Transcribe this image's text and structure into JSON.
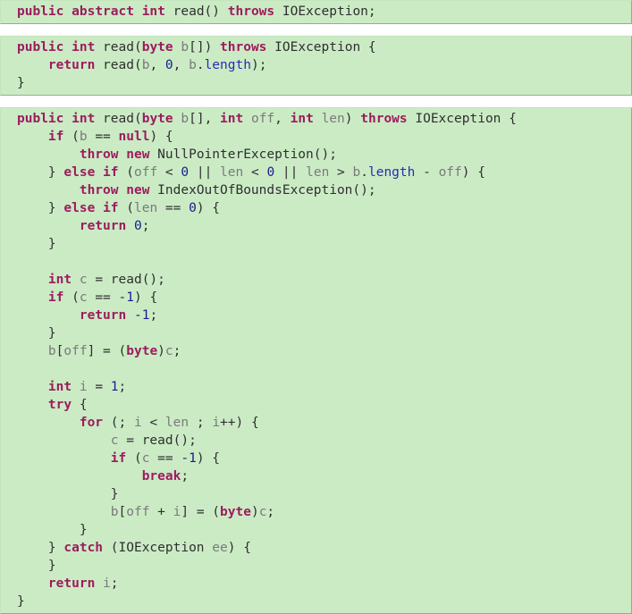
{
  "figure": {
    "name": "java-inputstream-read-methods-code-listing",
    "language": "Java",
    "colors": {
      "background": "#ffffff",
      "code_background": "#cbebc5",
      "keyword": "#9c1c5e",
      "identifier": "#2f2f2f",
      "variable": "#7a7a7a",
      "number": "#1b1b8c",
      "field": "#2a2ab0",
      "border": "#9aa89a"
    }
  },
  "blocks": [
    {
      "id": "block-1",
      "name": "abstract-read-declaration",
      "lines": [
        {
          "indent": 0,
          "tokens": [
            {
              "t": "public",
              "c": "kw"
            },
            {
              "t": " ",
              "c": "punc"
            },
            {
              "t": "abstract",
              "c": "kw"
            },
            {
              "t": " ",
              "c": "punc"
            },
            {
              "t": "int",
              "c": "kw"
            },
            {
              "t": " read() ",
              "c": "plain"
            },
            {
              "t": "throws",
              "c": "kw"
            },
            {
              "t": " IOException;",
              "c": "plain"
            }
          ]
        }
      ]
    },
    {
      "id": "block-2",
      "name": "read-byte-array-method",
      "lines": [
        {
          "indent": 0,
          "tokens": [
            {
              "t": "public",
              "c": "kw"
            },
            {
              "t": " ",
              "c": "punc"
            },
            {
              "t": "int",
              "c": "kw"
            },
            {
              "t": " read(",
              "c": "plain"
            },
            {
              "t": "byte",
              "c": "kw"
            },
            {
              "t": " ",
              "c": "punc"
            },
            {
              "t": "b",
              "c": "var"
            },
            {
              "t": "[]) ",
              "c": "plain"
            },
            {
              "t": "throws",
              "c": "kw"
            },
            {
              "t": " IOException {",
              "c": "plain"
            }
          ]
        },
        {
          "indent": 1,
          "tokens": [
            {
              "t": "return",
              "c": "kw"
            },
            {
              "t": " read(",
              "c": "plain"
            },
            {
              "t": "b",
              "c": "var"
            },
            {
              "t": ", ",
              "c": "plain"
            },
            {
              "t": "0",
              "c": "num"
            },
            {
              "t": ", ",
              "c": "plain"
            },
            {
              "t": "b",
              "c": "var"
            },
            {
              "t": ".",
              "c": "plain"
            },
            {
              "t": "length",
              "c": "fld"
            },
            {
              "t": ");",
              "c": "plain"
            }
          ]
        },
        {
          "indent": 0,
          "tokens": [
            {
              "t": "}",
              "c": "plain"
            }
          ]
        }
      ]
    },
    {
      "id": "block-3",
      "name": "read-byte-array-offset-length-method",
      "lines": [
        {
          "indent": 0,
          "tokens": [
            {
              "t": "public",
              "c": "kw"
            },
            {
              "t": " ",
              "c": "punc"
            },
            {
              "t": "int",
              "c": "kw"
            },
            {
              "t": " read(",
              "c": "plain"
            },
            {
              "t": "byte",
              "c": "kw"
            },
            {
              "t": " ",
              "c": "punc"
            },
            {
              "t": "b",
              "c": "var"
            },
            {
              "t": "[], ",
              "c": "plain"
            },
            {
              "t": "int",
              "c": "kw"
            },
            {
              "t": " ",
              "c": "punc"
            },
            {
              "t": "off",
              "c": "var"
            },
            {
              "t": ", ",
              "c": "plain"
            },
            {
              "t": "int",
              "c": "kw"
            },
            {
              "t": " ",
              "c": "punc"
            },
            {
              "t": "len",
              "c": "var"
            },
            {
              "t": ") ",
              "c": "plain"
            },
            {
              "t": "throws",
              "c": "kw"
            },
            {
              "t": " IOException {",
              "c": "plain"
            }
          ]
        },
        {
          "indent": 1,
          "tokens": [
            {
              "t": "if",
              "c": "kw"
            },
            {
              "t": " (",
              "c": "plain"
            },
            {
              "t": "b",
              "c": "var"
            },
            {
              "t": " == ",
              "c": "plain"
            },
            {
              "t": "null",
              "c": "kw"
            },
            {
              "t": ") {",
              "c": "plain"
            }
          ]
        },
        {
          "indent": 2,
          "tokens": [
            {
              "t": "throw",
              "c": "kw"
            },
            {
              "t": " ",
              "c": "punc"
            },
            {
              "t": "new",
              "c": "kw"
            },
            {
              "t": " NullPointerException();",
              "c": "plain"
            }
          ]
        },
        {
          "indent": 1,
          "tokens": [
            {
              "t": "} ",
              "c": "plain"
            },
            {
              "t": "else",
              "c": "kw"
            },
            {
              "t": " ",
              "c": "punc"
            },
            {
              "t": "if",
              "c": "kw"
            },
            {
              "t": " (",
              "c": "plain"
            },
            {
              "t": "off",
              "c": "var"
            },
            {
              "t": " < ",
              "c": "plain"
            },
            {
              "t": "0",
              "c": "num"
            },
            {
              "t": " || ",
              "c": "plain"
            },
            {
              "t": "len",
              "c": "var"
            },
            {
              "t": " < ",
              "c": "plain"
            },
            {
              "t": "0",
              "c": "num"
            },
            {
              "t": " || ",
              "c": "plain"
            },
            {
              "t": "len",
              "c": "var"
            },
            {
              "t": " > ",
              "c": "plain"
            },
            {
              "t": "b",
              "c": "var"
            },
            {
              "t": ".",
              "c": "plain"
            },
            {
              "t": "length",
              "c": "fld"
            },
            {
              "t": " - ",
              "c": "plain"
            },
            {
              "t": "off",
              "c": "var"
            },
            {
              "t": ") {",
              "c": "plain"
            }
          ]
        },
        {
          "indent": 2,
          "tokens": [
            {
              "t": "throw",
              "c": "kw"
            },
            {
              "t": " ",
              "c": "punc"
            },
            {
              "t": "new",
              "c": "kw"
            },
            {
              "t": " IndexOutOfBoundsException();",
              "c": "plain"
            }
          ]
        },
        {
          "indent": 1,
          "tokens": [
            {
              "t": "} ",
              "c": "plain"
            },
            {
              "t": "else",
              "c": "kw"
            },
            {
              "t": " ",
              "c": "punc"
            },
            {
              "t": "if",
              "c": "kw"
            },
            {
              "t": " (",
              "c": "plain"
            },
            {
              "t": "len",
              "c": "var"
            },
            {
              "t": " == ",
              "c": "plain"
            },
            {
              "t": "0",
              "c": "num"
            },
            {
              "t": ") {",
              "c": "plain"
            }
          ]
        },
        {
          "indent": 2,
          "tokens": [
            {
              "t": "return",
              "c": "kw"
            },
            {
              "t": " ",
              "c": "punc"
            },
            {
              "t": "0",
              "c": "num"
            },
            {
              "t": ";",
              "c": "plain"
            }
          ]
        },
        {
          "indent": 1,
          "tokens": [
            {
              "t": "}",
              "c": "plain"
            }
          ]
        },
        {
          "indent": 0,
          "blank": true,
          "tokens": []
        },
        {
          "indent": 1,
          "tokens": [
            {
              "t": "int",
              "c": "kw"
            },
            {
              "t": " ",
              "c": "punc"
            },
            {
              "t": "c",
              "c": "var"
            },
            {
              "t": " = read();",
              "c": "plain"
            }
          ]
        },
        {
          "indent": 1,
          "tokens": [
            {
              "t": "if",
              "c": "kw"
            },
            {
              "t": " (",
              "c": "plain"
            },
            {
              "t": "c",
              "c": "var"
            },
            {
              "t": " == ",
              "c": "plain"
            },
            {
              "t": "-1",
              "c": "num"
            },
            {
              "t": ") {",
              "c": "plain"
            }
          ]
        },
        {
          "indent": 2,
          "tokens": [
            {
              "t": "return",
              "c": "kw"
            },
            {
              "t": " ",
              "c": "punc"
            },
            {
              "t": "-1",
              "c": "num"
            },
            {
              "t": ";",
              "c": "plain"
            }
          ]
        },
        {
          "indent": 1,
          "tokens": [
            {
              "t": "}",
              "c": "plain"
            }
          ]
        },
        {
          "indent": 1,
          "tokens": [
            {
              "t": "b",
              "c": "var"
            },
            {
              "t": "[",
              "c": "plain"
            },
            {
              "t": "off",
              "c": "var"
            },
            {
              "t": "] = (",
              "c": "plain"
            },
            {
              "t": "byte",
              "c": "kw"
            },
            {
              "t": ")",
              "c": "plain"
            },
            {
              "t": "c",
              "c": "var"
            },
            {
              "t": ";",
              "c": "plain"
            }
          ]
        },
        {
          "indent": 0,
          "blank": true,
          "tokens": []
        },
        {
          "indent": 1,
          "tokens": [
            {
              "t": "int",
              "c": "kw"
            },
            {
              "t": " ",
              "c": "punc"
            },
            {
              "t": "i",
              "c": "var"
            },
            {
              "t": " = ",
              "c": "plain"
            },
            {
              "t": "1",
              "c": "num"
            },
            {
              "t": ";",
              "c": "plain"
            }
          ]
        },
        {
          "indent": 1,
          "tokens": [
            {
              "t": "try",
              "c": "kw"
            },
            {
              "t": " {",
              "c": "plain"
            }
          ]
        },
        {
          "indent": 2,
          "tokens": [
            {
              "t": "for",
              "c": "kw"
            },
            {
              "t": " (; ",
              "c": "plain"
            },
            {
              "t": "i",
              "c": "var"
            },
            {
              "t": " < ",
              "c": "plain"
            },
            {
              "t": "len",
              "c": "var"
            },
            {
              "t": " ; ",
              "c": "plain"
            },
            {
              "t": "i",
              "c": "var"
            },
            {
              "t": "++) {",
              "c": "plain"
            }
          ]
        },
        {
          "indent": 3,
          "tokens": [
            {
              "t": "c",
              "c": "var"
            },
            {
              "t": " = read();",
              "c": "plain"
            }
          ]
        },
        {
          "indent": 3,
          "tokens": [
            {
              "t": "if",
              "c": "kw"
            },
            {
              "t": " (",
              "c": "plain"
            },
            {
              "t": "c",
              "c": "var"
            },
            {
              "t": " == ",
              "c": "plain"
            },
            {
              "t": "-1",
              "c": "num"
            },
            {
              "t": ") {",
              "c": "plain"
            }
          ]
        },
        {
          "indent": 4,
          "tokens": [
            {
              "t": "break",
              "c": "kw"
            },
            {
              "t": ";",
              "c": "plain"
            }
          ]
        },
        {
          "indent": 3,
          "tokens": [
            {
              "t": "}",
              "c": "plain"
            }
          ]
        },
        {
          "indent": 3,
          "tokens": [
            {
              "t": "b",
              "c": "var"
            },
            {
              "t": "[",
              "c": "plain"
            },
            {
              "t": "off",
              "c": "var"
            },
            {
              "t": " + ",
              "c": "plain"
            },
            {
              "t": "i",
              "c": "var"
            },
            {
              "t": "] = (",
              "c": "plain"
            },
            {
              "t": "byte",
              "c": "kw"
            },
            {
              "t": ")",
              "c": "plain"
            },
            {
              "t": "c",
              "c": "var"
            },
            {
              "t": ";",
              "c": "plain"
            }
          ]
        },
        {
          "indent": 2,
          "tokens": [
            {
              "t": "}",
              "c": "plain"
            }
          ]
        },
        {
          "indent": 1,
          "tokens": [
            {
              "t": "} ",
              "c": "plain"
            },
            {
              "t": "catch",
              "c": "kw"
            },
            {
              "t": " (IOException ",
              "c": "plain"
            },
            {
              "t": "ee",
              "c": "var"
            },
            {
              "t": ") {",
              "c": "plain"
            }
          ]
        },
        {
          "indent": 1,
          "tokens": [
            {
              "t": "}",
              "c": "plain"
            }
          ]
        },
        {
          "indent": 1,
          "tokens": [
            {
              "t": "return",
              "c": "kw"
            },
            {
              "t": " ",
              "c": "punc"
            },
            {
              "t": "i",
              "c": "var"
            },
            {
              "t": ";",
              "c": "plain"
            }
          ]
        },
        {
          "indent": 0,
          "tokens": [
            {
              "t": "}",
              "c": "plain"
            }
          ]
        }
      ]
    }
  ]
}
